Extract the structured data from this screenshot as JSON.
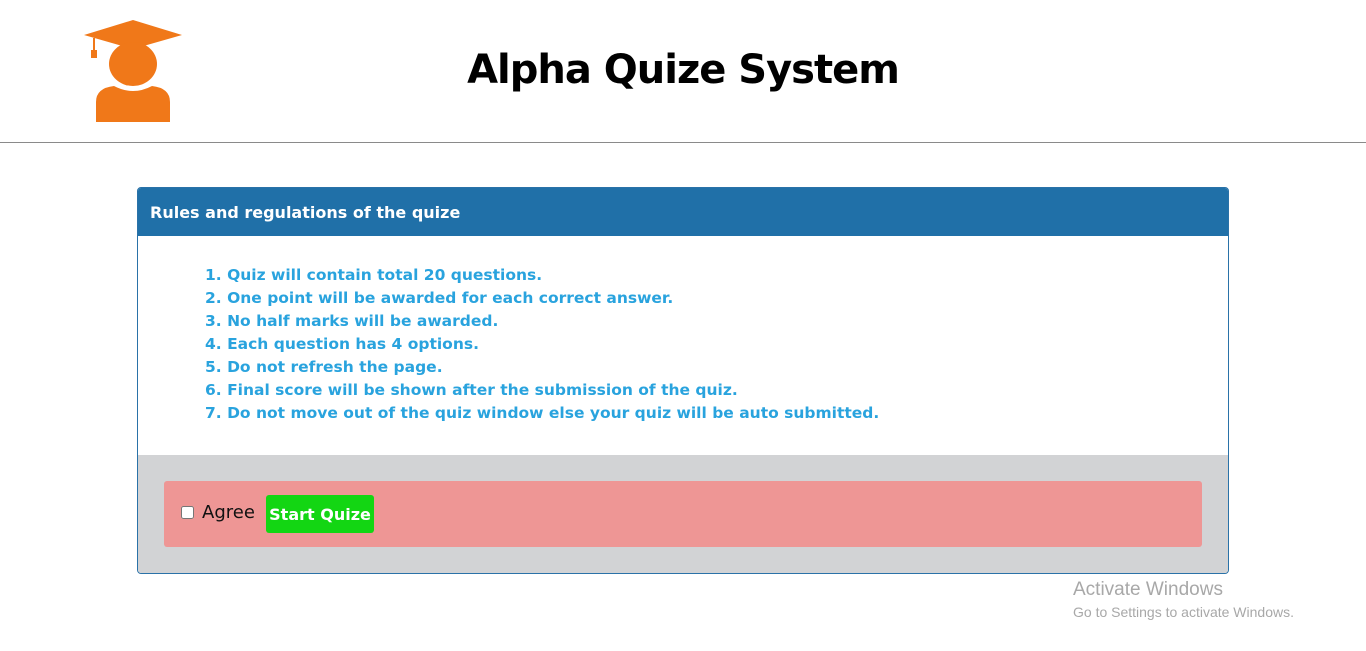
{
  "header": {
    "title": "Alpha Quize System",
    "logo_icon": "graduate-cap-person-icon",
    "logo_color": "#f07819"
  },
  "panel": {
    "heading": "Rules and regulations of the quize",
    "heading_color": "#2070a8",
    "rules": [
      "1. Quiz will contain total 20 questions.",
      "2. One point will be awarded for each correct answer.",
      "3. No half marks will be awarded.",
      "4. Each question has 4 options.",
      "5. Do not refresh the page.",
      "6. Final score will be shown after the submission of the quiz.",
      "7. Do not move out of the quiz window else your quiz will be auto submitted."
    ],
    "rules_color": "#29a3de"
  },
  "agreement": {
    "checkbox_label": "Agree",
    "checked": false,
    "start_button_label": "Start Quize",
    "start_button_color": "#13d613",
    "box_color": "#ee9695"
  },
  "watermark": {
    "title": "Activate Windows",
    "subtitle": "Go to Settings to activate Windows."
  }
}
